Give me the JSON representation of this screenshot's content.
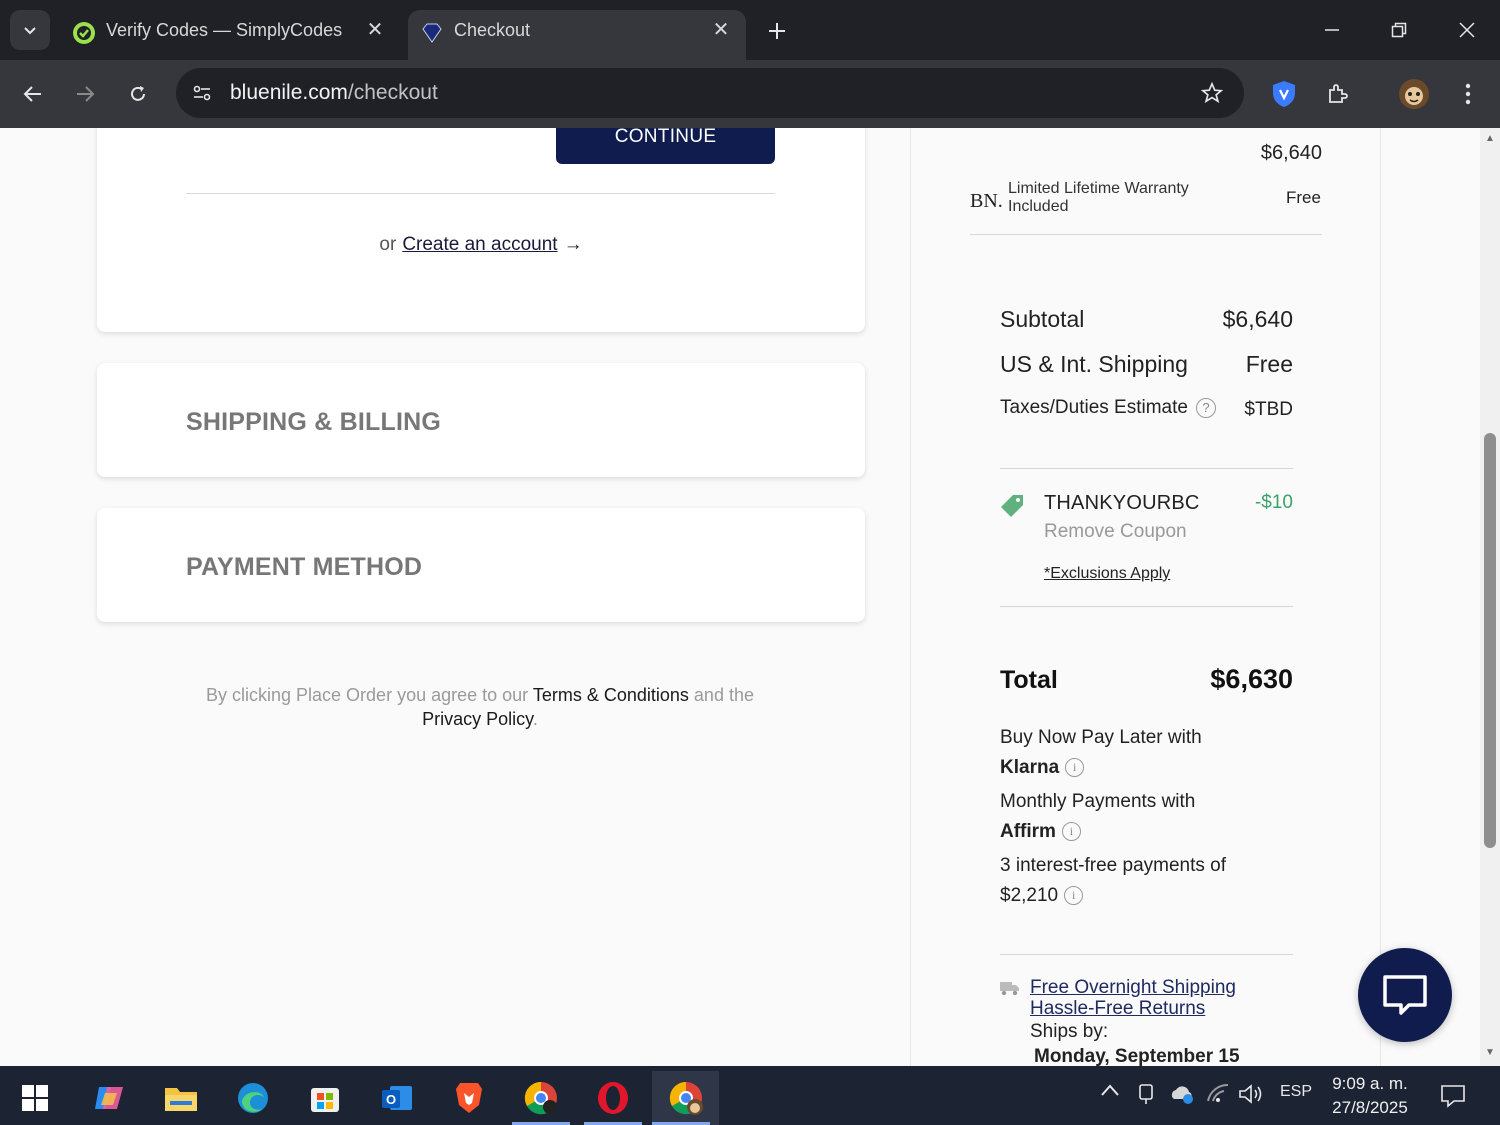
{
  "browser": {
    "tabs": [
      {
        "title": "Verify Codes — SimplyCodes",
        "favicon": "simplycodes-icon"
      },
      {
        "title": "Checkout",
        "favicon": "bluenile-diamond-icon"
      }
    ],
    "url": {
      "domain": "bluenile.com",
      "path": "/checkout"
    }
  },
  "checkout": {
    "continue_label": "CONTINUE",
    "or_label": "or",
    "create_account_label": "Create an account",
    "create_account_arrow": "→",
    "shipping_billing_title": "SHIPPING & BILLING",
    "payment_method_title": "PAYMENT METHOD",
    "terms": {
      "prefix": "By clicking Place Order you agree to our",
      "terms_link": "Terms & Conditions",
      "middle": "and the",
      "privacy_link": "Privacy Policy",
      "suffix": "."
    }
  },
  "summary": {
    "item_price": "$6,640",
    "warranty_logo": "BN.",
    "warranty_label": "Limited Lifetime Warranty Included",
    "warranty_value": "Free",
    "subtotal_label": "Subtotal",
    "subtotal_value": "$6,640",
    "shipping_label": "US & Int. Shipping",
    "shipping_value": "Free",
    "taxes_label": "Taxes/Duties Estimate",
    "taxes_help": "?",
    "taxes_value": "$TBD",
    "coupon_code": "THANKYOURBC",
    "coupon_remove": "Remove Coupon",
    "coupon_value": "-$10",
    "exclusions": "*Exclusions Apply",
    "total_label": "Total",
    "total_value": "$6,630",
    "klarna_text": "Buy Now Pay Later with",
    "klarna_brand": "Klarna",
    "affirm_text": "Monthly Payments with",
    "affirm_brand": "Affirm",
    "installments_text": "3 interest-free payments of",
    "installments_value": "$2,210",
    "info_glyph": "i",
    "free_shipping_link": "Free Overnight Shipping",
    "returns_link": "Hassle-Free Returns",
    "ships_by_label": "Ships by:",
    "ships_by_date": "Monday, September 15"
  },
  "taskbar": {
    "language": "ESP",
    "time": "9:09 a. m.",
    "date": "27/8/2025"
  },
  "colors": {
    "brand_navy": "#0f1c4d",
    "coupon_green": "#3aa36a",
    "browser_dark": "#1f2127"
  }
}
